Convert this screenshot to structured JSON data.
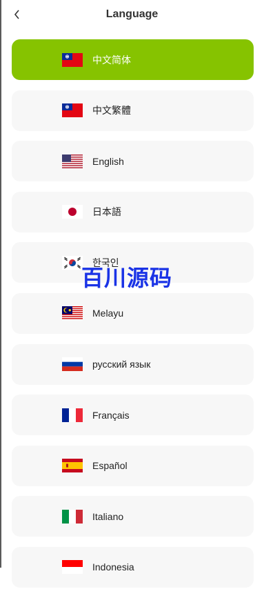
{
  "header": {
    "title": "Language",
    "back_icon": "chevron-left-icon"
  },
  "languages": [
    {
      "label": "中文简体",
      "flag": "taiwan-flag-icon",
      "active": true
    },
    {
      "label": "中文繁體",
      "flag": "taiwan-flag-icon",
      "active": false
    },
    {
      "label": "English",
      "flag": "usa-flag-icon",
      "active": false
    },
    {
      "label": "日本語",
      "flag": "japan-flag-icon",
      "active": false
    },
    {
      "label": "한국인",
      "flag": "korea-flag-icon",
      "active": false
    },
    {
      "label": "Melayu",
      "flag": "malaysia-flag-icon",
      "active": false
    },
    {
      "label": "русский язык",
      "flag": "russia-flag-icon",
      "active": false
    },
    {
      "label": "Français",
      "flag": "france-flag-icon",
      "active": false
    },
    {
      "label": "Español",
      "flag": "spain-flag-icon",
      "active": false
    },
    {
      "label": "Italiano",
      "flag": "italy-flag-icon",
      "active": false
    },
    {
      "label": "Indonesia",
      "flag": "indonesia-flag-icon",
      "active": false
    }
  ],
  "watermark": "百川源码",
  "colors": {
    "active_bg": "#86c300",
    "item_bg": "#f7f7f7",
    "watermark": "#1a33e6"
  }
}
